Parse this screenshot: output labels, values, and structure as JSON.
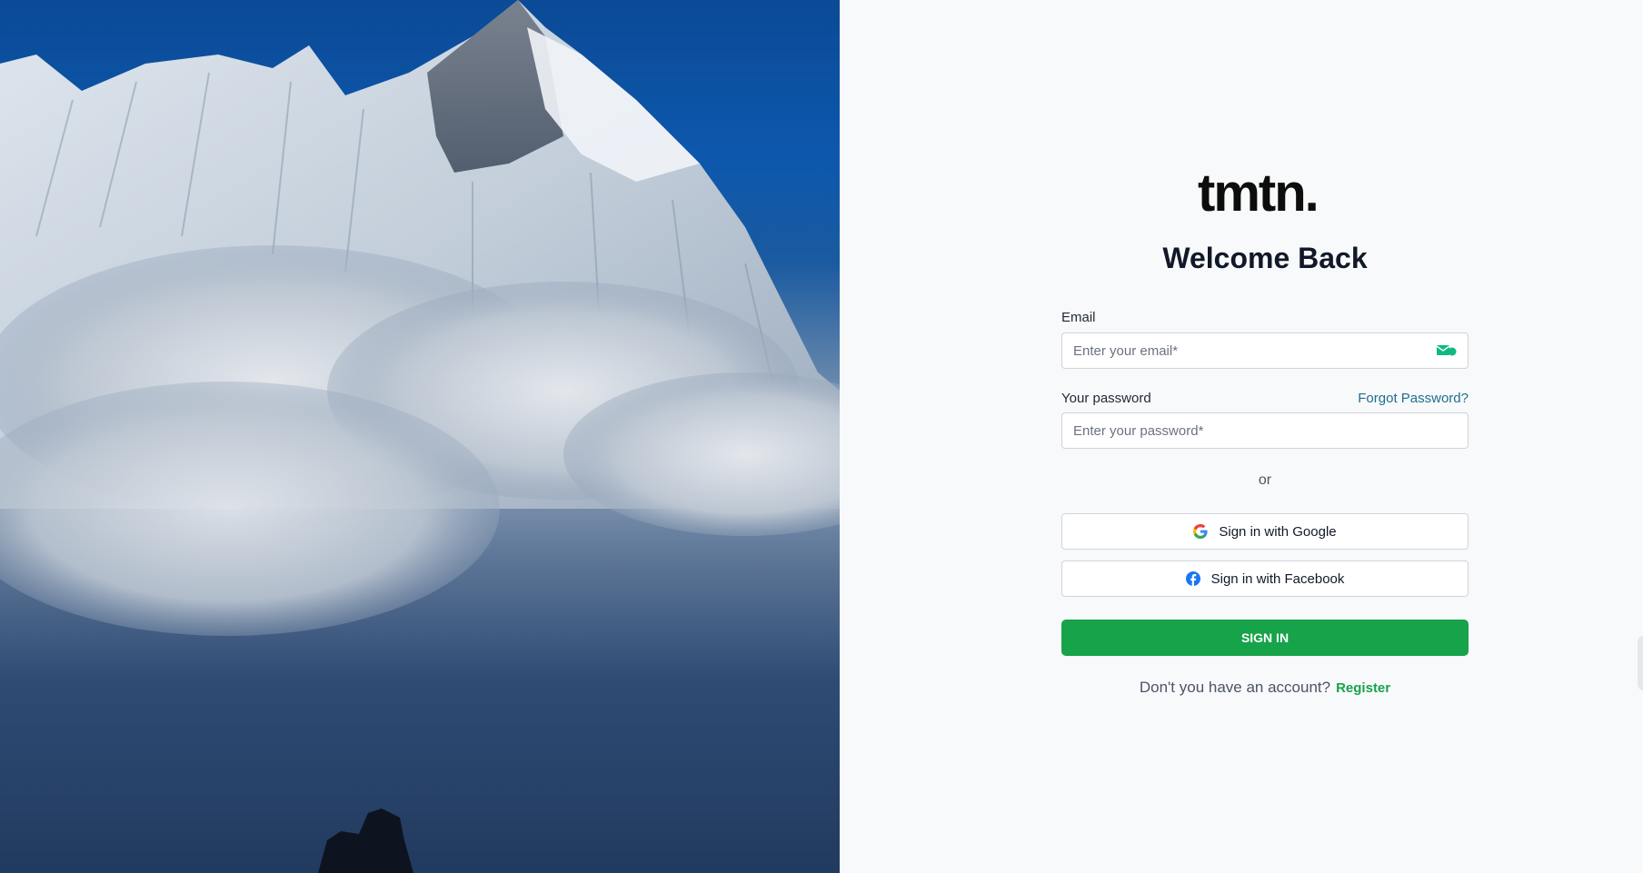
{
  "hero": {
    "image": "mountain-clouds-photo",
    "colors": {
      "sky": "#0d58ad",
      "snow": "#e8edf3",
      "cloud": "#c9d2dc"
    }
  },
  "brand": {
    "logo_text": "tmtn."
  },
  "form": {
    "heading": "Welcome Back",
    "email_label": "Email",
    "email_placeholder": "Enter your email*",
    "password_label": "Your password",
    "forgot_label": "Forgot Password?",
    "password_placeholder": "Enter your password*",
    "or_text": "or",
    "google_label": "Sign in with Google",
    "facebook_label": "Sign in with Facebook",
    "signin_label": "SIGN IN",
    "register_prompt": "Don't you have an account?",
    "register_label": "Register"
  },
  "icons": {
    "email_field": "mail-icon",
    "google": "google-icon",
    "facebook": "facebook-icon"
  },
  "colors": {
    "accent": "#16a34a",
    "link": "#1f6f8b",
    "text": "#111827"
  }
}
